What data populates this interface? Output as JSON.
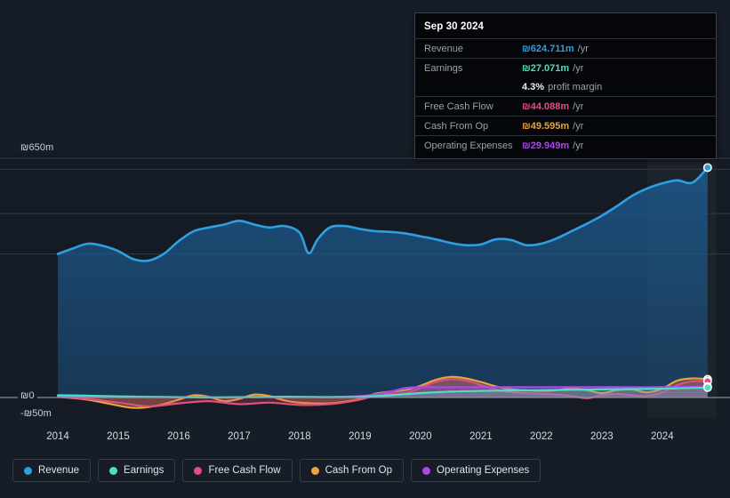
{
  "chart_data": {
    "type": "area",
    "title": "",
    "xlabel": "",
    "ylabel": "",
    "currency_symbol": "₪",
    "ylim": [
      -50,
      650
    ],
    "y_ticks": [
      {
        "value": 650,
        "label": "₪650m"
      },
      {
        "value": 0,
        "label": "₪0"
      },
      {
        "value": -50,
        "label": "-₪50m"
      }
    ],
    "grid": true,
    "legend_position": "bottom-left",
    "x_ticks": [
      "2014",
      "2015",
      "2016",
      "2017",
      "2018",
      "2019",
      "2020",
      "2021",
      "2022",
      "2023",
      "2024"
    ],
    "x_range": [
      2013.75,
      2024.9
    ],
    "highlight_band": {
      "from": 2023.75,
      "to": 2024.9
    },
    "series": [
      {
        "name": "Revenue",
        "color": "#2e9fe0",
        "fill": "rgba(30,95,150,0.45)",
        "x": [
          2014.0,
          2014.25,
          2014.5,
          2014.75,
          2015.0,
          2015.25,
          2015.5,
          2015.75,
          2016.0,
          2016.25,
          2016.5,
          2016.75,
          2017.0,
          2017.25,
          2017.5,
          2017.75,
          2018.0,
          2018.15,
          2018.3,
          2018.5,
          2018.75,
          2019.0,
          2019.25,
          2019.5,
          2019.75,
          2020.0,
          2020.25,
          2020.5,
          2020.75,
          2021.0,
          2021.25,
          2021.5,
          2021.75,
          2022.0,
          2022.25,
          2022.5,
          2022.75,
          2023.0,
          2023.25,
          2023.5,
          2023.75,
          2024.0,
          2024.25,
          2024.5,
          2024.75
        ],
        "values": [
          390,
          405,
          418,
          412,
          398,
          376,
          372,
          390,
          425,
          452,
          462,
          470,
          480,
          470,
          462,
          466,
          448,
          392,
          430,
          462,
          466,
          458,
          452,
          450,
          446,
          438,
          430,
          420,
          414,
          416,
          430,
          428,
          414,
          418,
          432,
          452,
          472,
          494,
          520,
          548,
          568,
          582,
          590,
          584,
          624.711
        ]
      },
      {
        "name": "Earnings",
        "color": "#4ce0c0",
        "fill": "rgba(76,224,192,0.22)",
        "x": [
          2014.0,
          2014.5,
          2015.0,
          2015.5,
          2016.0,
          2016.5,
          2017.0,
          2017.5,
          2018.0,
          2018.5,
          2019.0,
          2019.5,
          2020.0,
          2020.5,
          2021.0,
          2021.5,
          2022.0,
          2022.5,
          2023.0,
          2023.5,
          2024.0,
          2024.75
        ],
        "values": [
          6,
          5,
          3,
          2,
          1,
          0,
          1,
          2,
          2,
          1,
          2,
          6,
          12,
          16,
          18,
          19,
          20,
          21,
          22,
          23,
          24,
          27.071
        ]
      },
      {
        "name": "Free Cash Flow",
        "color": "#e04f7f",
        "fill": "rgba(224,79,127,0.25)",
        "x": [
          2014.0,
          2014.5,
          2015.0,
          2015.5,
          2016.0,
          2016.5,
          2017.0,
          2017.5,
          2018.0,
          2018.5,
          2019.0,
          2019.25,
          2019.5,
          2019.75,
          2020.0,
          2020.25,
          2020.5,
          2020.75,
          2021.0,
          2021.25,
          2021.5,
          2021.75,
          2022.0,
          2022.25,
          2022.5,
          2022.75,
          2023.0,
          2023.25,
          2023.5,
          2023.75,
          2024.0,
          2024.25,
          2024.5,
          2024.75
        ],
        "values": [
          2,
          -4,
          -14,
          -24,
          -16,
          -10,
          -18,
          -14,
          -20,
          -18,
          -6,
          6,
          10,
          12,
          26,
          42,
          50,
          46,
          34,
          22,
          14,
          12,
          10,
          8,
          4,
          -2,
          6,
          10,
          6,
          4,
          14,
          34,
          44,
          44.088
        ]
      },
      {
        "name": "Cash From Op",
        "color": "#e8a33d",
        "fill": "rgba(232,163,61,0.28)",
        "x": [
          2014.0,
          2014.5,
          2015.0,
          2015.25,
          2015.5,
          2015.75,
          2016.0,
          2016.25,
          2016.5,
          2016.75,
          2017.0,
          2017.25,
          2017.5,
          2017.75,
          2018.0,
          2018.5,
          2019.0,
          2019.25,
          2019.5,
          2019.75,
          2020.0,
          2020.25,
          2020.5,
          2020.75,
          2021.0,
          2021.25,
          2021.5,
          2021.75,
          2022.0,
          2022.25,
          2022.5,
          2022.75,
          2023.0,
          2023.25,
          2023.5,
          2023.75,
          2024.0,
          2024.25,
          2024.5,
          2024.75
        ],
        "values": [
          2,
          -6,
          -22,
          -28,
          -26,
          -18,
          -6,
          6,
          2,
          -10,
          -4,
          8,
          4,
          -8,
          -14,
          -16,
          -4,
          10,
          16,
          20,
          32,
          48,
          56,
          52,
          42,
          30,
          22,
          20,
          18,
          20,
          24,
          20,
          12,
          20,
          22,
          14,
          24,
          46,
          52,
          49.595
        ]
      },
      {
        "name": "Operating Expenses",
        "color": "#a94ae8",
        "fill": "rgba(169,74,232,0.25)",
        "x": [
          2014.0,
          2015.0,
          2016.0,
          2017.0,
          2018.0,
          2019.0,
          2019.5,
          2019.75,
          2020.0,
          2020.5,
          2021.0,
          2021.5,
          2022.0,
          2022.5,
          2023.0,
          2023.5,
          2024.0,
          2024.75
        ],
        "values": [
          2,
          1,
          1,
          1,
          1,
          4,
          16,
          26,
          28,
          28,
          28,
          28,
          28,
          28,
          28,
          28,
          28,
          29.949
        ]
      }
    ],
    "endpoint_markers": [
      {
        "series": "Revenue",
        "x": 2024.75,
        "value": 624.711
      },
      {
        "series": "Cash From Op",
        "x": 2024.75,
        "value": 49.595
      },
      {
        "series": "Free Cash Flow",
        "x": 2024.75,
        "value": 44.088
      },
      {
        "series": "Operating Expenses",
        "x": 2024.75,
        "value": 29.949
      },
      {
        "series": "Earnings",
        "x": 2024.75,
        "value": 27.071
      }
    ]
  },
  "tooltip": {
    "date": "Sep 30 2024",
    "rows": [
      {
        "key": "Revenue",
        "value": "₪624.711m",
        "unit": "/yr",
        "color": "#2e9fe0"
      },
      {
        "key": "Earnings",
        "value": "₪27.071m",
        "unit": "/yr",
        "color": "#4ce0c0"
      },
      {
        "key": "Free Cash Flow",
        "value": "₪44.088m",
        "unit": "/yr",
        "color": "#e04f7f"
      },
      {
        "key": "Cash From Op",
        "value": "₪49.595m",
        "unit": "/yr",
        "color": "#e8a33d"
      },
      {
        "key": "Operating Expenses",
        "value": "₪29.949m",
        "unit": "/yr",
        "color": "#a94ae8"
      }
    ],
    "profit_margin": {
      "value": "4.3%",
      "label": "profit margin"
    }
  },
  "legend": {
    "items": [
      {
        "label": "Revenue",
        "color": "#2e9fe0"
      },
      {
        "label": "Earnings",
        "color": "#4ce0c0"
      },
      {
        "label": "Free Cash Flow",
        "color": "#e04f7f"
      },
      {
        "label": "Cash From Op",
        "color": "#e8a33d"
      },
      {
        "label": "Operating Expenses",
        "color": "#a94ae8"
      }
    ]
  },
  "axis": {
    "y_top_label": "₪650m",
    "y_zero_label": "₪0",
    "y_bottom_label": "-₪50m"
  }
}
